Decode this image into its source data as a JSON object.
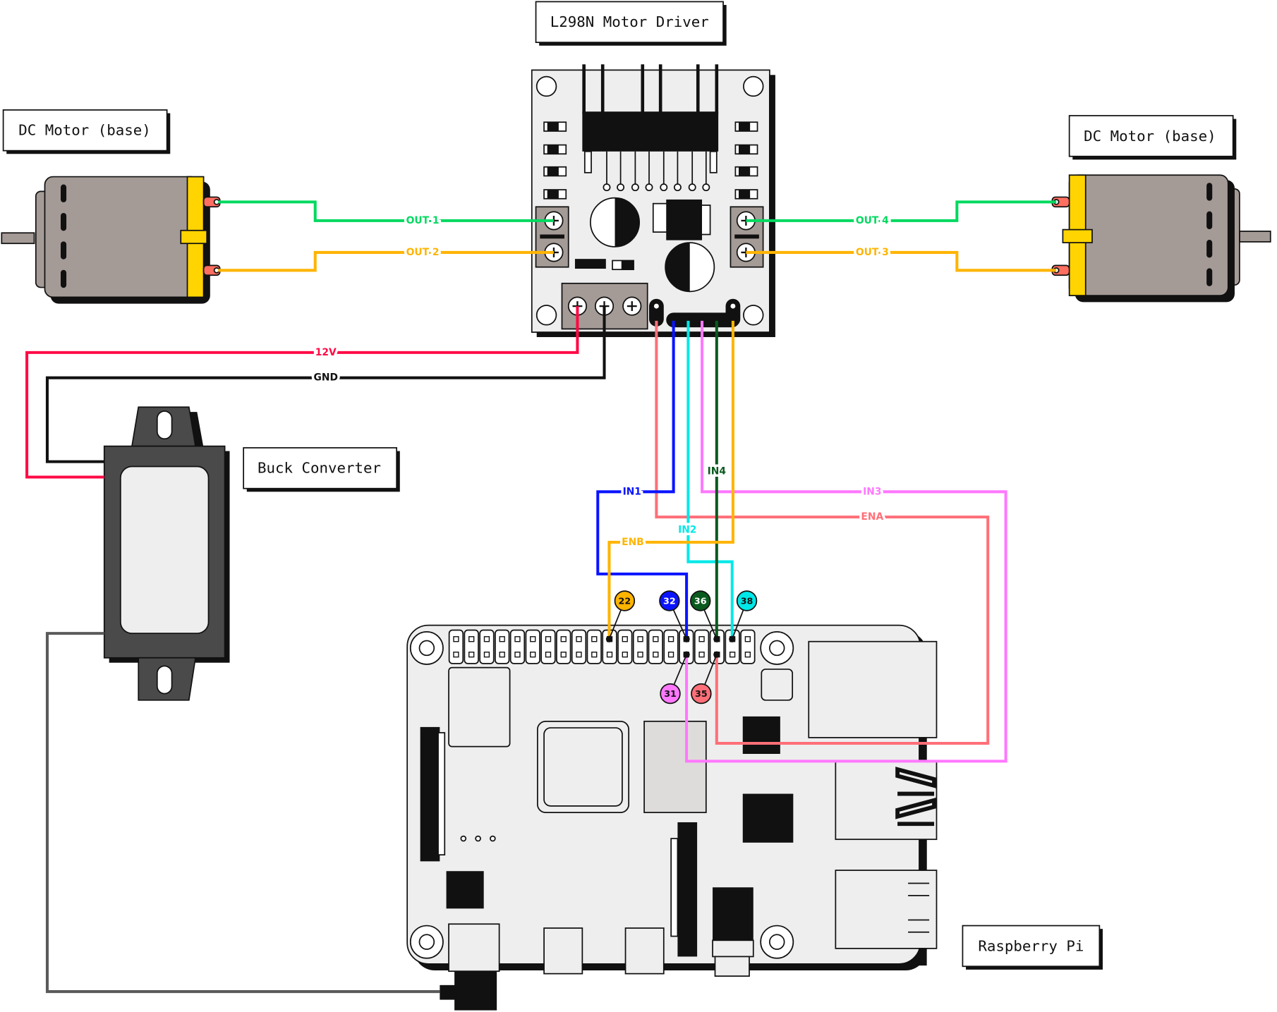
{
  "components": {
    "driver": "L298N Motor Driver",
    "motor_left": "DC Motor (base)",
    "motor_right": "DC Motor (base)",
    "buck": "Buck Converter",
    "pi": "Raspberry Pi"
  },
  "wires": {
    "out1": {
      "label": "OUT 1",
      "color": "#00d95f"
    },
    "out2": {
      "label": "OUT 2",
      "color": "#ffb400"
    },
    "out3": {
      "label": "OUT 3",
      "color": "#ffb400"
    },
    "out4": {
      "label": "OUT 4",
      "color": "#00d95f"
    },
    "v12": {
      "label": "12V",
      "color": "#ff0a45"
    },
    "gnd": {
      "label": "GND",
      "color": "#111111"
    },
    "ena": {
      "label": "ENA",
      "color": "#ff6f78"
    },
    "in1": {
      "label": "IN1",
      "color": "#0a14ff"
    },
    "in2": {
      "label": "IN2",
      "color": "#00e8e8"
    },
    "in3": {
      "label": "IN3",
      "color": "#ff78ff"
    },
    "in4": {
      "label": "IN4",
      "color": "#0a5a1e"
    },
    "enb": {
      "label": "ENB",
      "color": "#ffb400"
    },
    "pi_power": {
      "color": "#5a5a5a"
    }
  },
  "pins": [
    {
      "num": "22",
      "color": "#ffb400",
      "text": "#111111"
    },
    {
      "num": "32",
      "color": "#0a14ff",
      "text": "#ffffff"
    },
    {
      "num": "36",
      "color": "#0a5a1e",
      "text": "#ffffff"
    },
    {
      "num": "38",
      "color": "#00e8e8",
      "text": "#111111"
    },
    {
      "num": "31",
      "color": "#ff78ff",
      "text": "#111111"
    },
    {
      "num": "35",
      "color": "#ff6f78",
      "text": "#111111"
    }
  ]
}
